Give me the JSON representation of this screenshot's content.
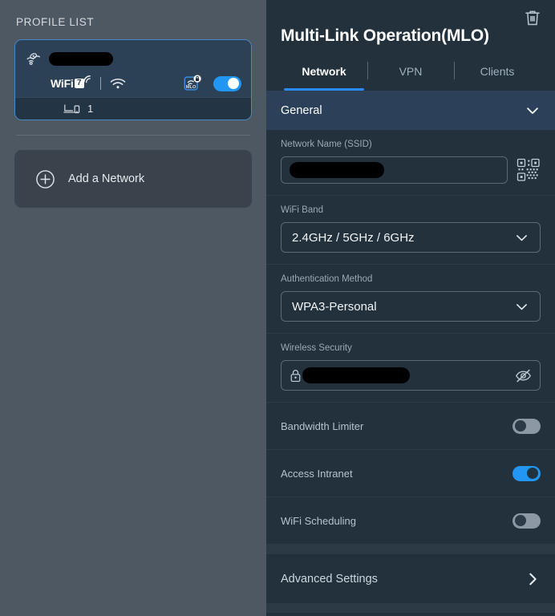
{
  "sidebar": {
    "title": "PROFILE LIST",
    "profile": {
      "ssid_redacted": true,
      "standard_label": "WiFi",
      "standard_generation": "7",
      "mlo_badge_label": "MLO",
      "device_count": "1",
      "enabled": true,
      "icons": {
        "profile_icon": "eye-network-icon",
        "wifi_signal_icon": "wifi-signal-icon",
        "mlo_icon": "mlo-secure-icon",
        "devices_icon": "laptop-phone-icon"
      }
    },
    "add_network": {
      "label": "Add a Network",
      "icon": "plus-circle-icon"
    }
  },
  "panel": {
    "title": "Multi-Link Operation(MLO)",
    "delete_icon": "trash-icon",
    "tabs": [
      {
        "label": "Network",
        "active": true
      },
      {
        "label": "VPN",
        "active": false
      },
      {
        "label": "Clients",
        "active": false
      }
    ],
    "section": {
      "label": "General",
      "expand_icon": "chevron-down-icon",
      "expanded": true
    },
    "fields": {
      "ssid": {
        "label": "Network Name (SSID)",
        "value": "",
        "redacted": true,
        "qr_icon": "qr-code-icon"
      },
      "wifi_band": {
        "label": "WiFi Band",
        "value": "2.4GHz / 5GHz / 6GHz",
        "chevron_icon": "chevron-down-icon"
      },
      "auth_method": {
        "label": "Authentication Method",
        "value": "WPA3-Personal",
        "chevron_icon": "chevron-down-icon"
      },
      "wireless_security": {
        "label": "Wireless Security",
        "value": "",
        "redacted": true,
        "lock_icon": "lock-icon",
        "reveal_icon": "eye-off-icon"
      }
    },
    "switches": [
      {
        "label": "Bandwidth Limiter",
        "on": false
      },
      {
        "label": "Access Intranet",
        "on": true
      },
      {
        "label": "WiFi Scheduling",
        "on": false
      }
    ],
    "advanced": {
      "label": "Advanced Settings",
      "chevron_icon": "chevron-right-icon"
    }
  },
  "colors": {
    "sidebar_bg": "#4e5862",
    "panel_bg": "#22313c",
    "accent_blue": "#2196f3",
    "section_header_bg": "#2c4159",
    "card_bg": "#2d4156",
    "card_border": "#4a88c7",
    "toggle_off": "#8c98a4"
  }
}
